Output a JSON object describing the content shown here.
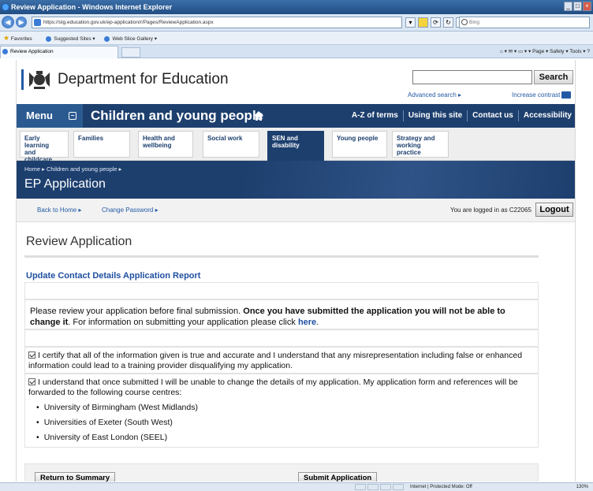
{
  "browser": {
    "window_title": "Review Application - Windows Internet Explorer",
    "url": "https://stg.education.gov.uk/ep-application/r/Pages/ReviewApplication.aspx",
    "search_placeholder": "Bing",
    "favorites_label": "Favorites",
    "favorites_links": [
      "Suggested Sites ▾",
      "Web Slice Gallery ▾"
    ],
    "tab_title": "Review Application",
    "command_bar": "▾ Page ▾ Safety ▾ Tools ▾",
    "status_zone": "Internet | Protected Mode: Off",
    "zoom": "130%"
  },
  "header": {
    "department": "Department for Education",
    "search_button": "Search",
    "advanced_search": "Advanced search ▸",
    "increase_contrast": "Increase contrast"
  },
  "mainnav": {
    "menu_label": "Menu",
    "section_title": "Children and young people",
    "links": [
      "A-Z of terms",
      "Using this site",
      "Contact us",
      "Accessibility"
    ]
  },
  "subnav": {
    "tabs": [
      {
        "label_line1": "Early learning",
        "label_line2": "and childcare",
        "label_line3": ""
      },
      {
        "label_line1": "Families",
        "label_line2": "",
        "label_line3": ""
      },
      {
        "label_line1": "Health and",
        "label_line2": "wellbeing",
        "label_line3": ""
      },
      {
        "label_line1": "Social work",
        "label_line2": "",
        "label_line3": ""
      },
      {
        "label_line1": "SEN and",
        "label_line2": "disability",
        "label_line3": ""
      },
      {
        "label_line1": "Young people",
        "label_line2": "",
        "label_line3": ""
      },
      {
        "label_line1": "Strategy and",
        "label_line2": "working",
        "label_line3": "practice"
      }
    ],
    "active_index": 4
  },
  "banner": {
    "breadcrumb": "Home ▸  Children and young people ▸",
    "heading": "EP Application"
  },
  "userbar": {
    "back_home": "Back to Home ▸",
    "change_password": "Change Password ▸",
    "logged_in_text": "You are logged in as C22065",
    "logout": "Logout"
  },
  "main": {
    "page_title": "Review Application",
    "report_title": "Update Contact Details Application Report",
    "intro_part1": "Please review your application before final submission. ",
    "intro_bold": "Once you have submitted the application you will not be able to change it",
    "intro_part2": ". For information on submitting your application please click ",
    "intro_link": "here",
    "intro_end": ".",
    "certify_text": "I certify that all of the information given is true and accurate and I understand that any misrepresentation including false or enhanced information could lead to a training provider disqualifying my application.",
    "understand_text": "I understand that once submitted I will be unable to change the details of my application. My application form and references will be forwarded to the following course centres:",
    "course_centres": [
      "University of Birmingham (West Midlands)",
      "Universities of Exeter (South West)",
      "University of East London (SEEL)"
    ],
    "return_button": "Return to Summary",
    "submit_button": "Submit Application"
  }
}
